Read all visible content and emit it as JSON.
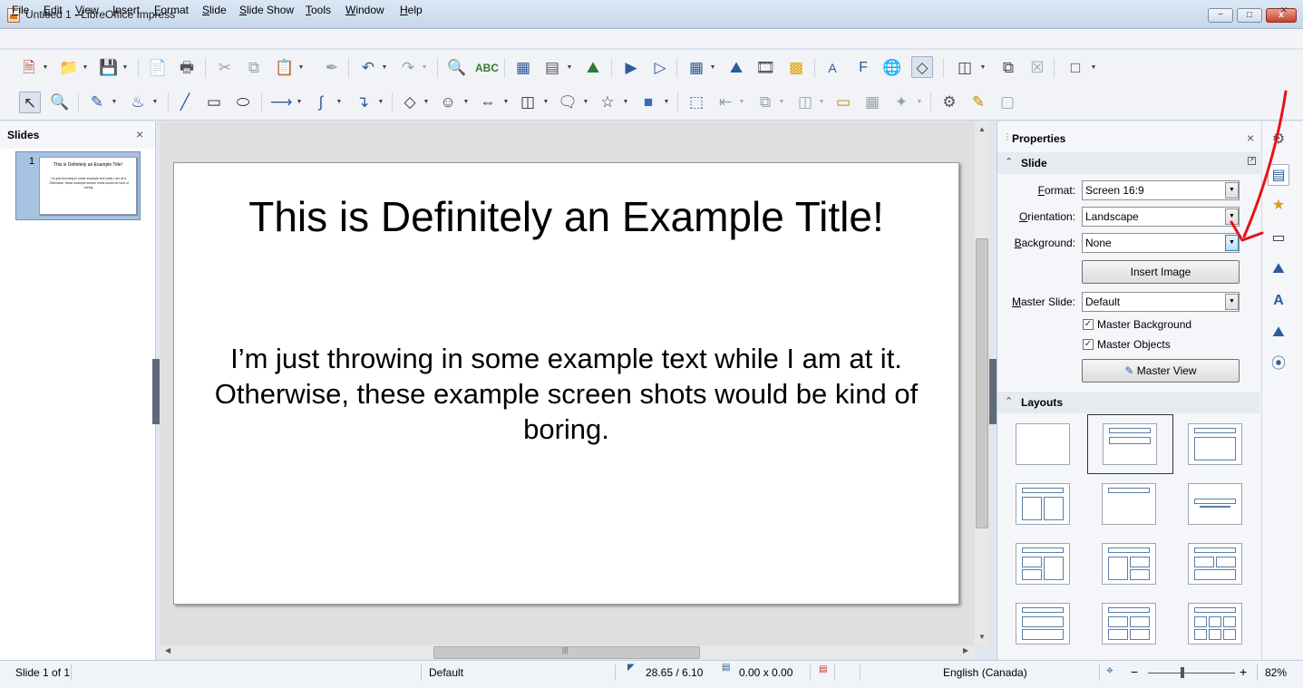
{
  "window": {
    "title": "Untitled 1 - LibreOffice Impress",
    "min_label": "−",
    "max_label": "□",
    "close_label": "x"
  },
  "menu": {
    "items": [
      "File",
      "Edit",
      "View",
      "Insert",
      "Format",
      "Slide",
      "Slide Show",
      "Tools",
      "Window",
      "Help"
    ],
    "doc_close": "×"
  },
  "slides_pane": {
    "title": "Slides",
    "close": "×",
    "thumbnail": {
      "number": "1",
      "title": "This is Definitely an Example Title!",
      "body": "I'm just throwing in some example text while I am at it. Otherwise, these example screen shots would be kind of boring."
    }
  },
  "slide": {
    "title": "This is Definitely an Example Title!",
    "body": "I’m just throwing in some example text while I am at it.  Otherwise, these example screen shots would be kind of boring."
  },
  "properties": {
    "title": "Properties",
    "close": "×",
    "slide_section": {
      "label": "Slide",
      "format_label": "Format:",
      "format_value": "Screen 16:9",
      "orientation_label": "Orientation:",
      "orientation_value": "Landscape",
      "background_label": "Background:",
      "background_value": "None",
      "insert_image": "Insert Image",
      "master_slide_label": "Master Slide:",
      "master_slide_value": "Default",
      "master_background_label": "Master Background",
      "master_background_checked": true,
      "master_objects_label": "Master Objects",
      "master_objects_checked": true,
      "master_view": "Master View"
    },
    "layouts_section": {
      "label": "Layouts",
      "selected_index": 1
    }
  },
  "statusbar": {
    "slide_info": "Slide 1 of 1",
    "master": "Default",
    "position": "28.65 / 6.10",
    "size": "0.00 x 0.00",
    "language": "English (Canada)",
    "zoom_minus": "−",
    "zoom_plus": "+",
    "zoom": "82%"
  },
  "annotation": {
    "arrow_color": "#e8121b"
  },
  "colors": {
    "accent": "#2d5c99",
    "selection": "#a8c3e2"
  }
}
